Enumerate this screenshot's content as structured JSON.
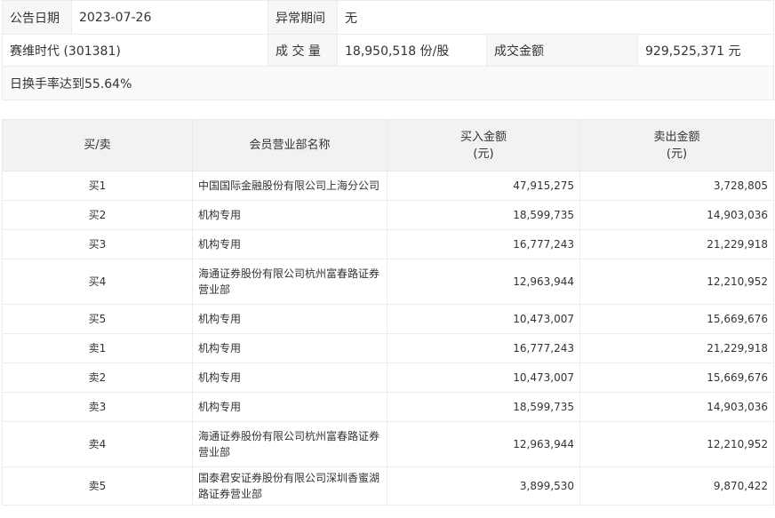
{
  "info": {
    "date_label": "公告日期",
    "date_value": "2023-07-26",
    "period_label": "异常期间",
    "period_value": "无",
    "stock_name": "赛维时代 (301381)",
    "volume_label": "成 交 量",
    "volume_value": "18,950,518 份/股",
    "amount_label": "成交金额",
    "amount_value": "929,525,371 元",
    "reason": "日换手率达到55.64%"
  },
  "table": {
    "headers": {
      "side": "买/卖",
      "branch": "会员营业部名称",
      "buy_line1": "买入金额",
      "buy_line2": "(元)",
      "sell_line1": "卖出金额",
      "sell_line2": "(元)"
    },
    "rows": [
      {
        "side": "买1",
        "branch": "中国国际金融股份有限公司上海分公司",
        "buy": "47,915,275",
        "sell": "3,728,805"
      },
      {
        "side": "买2",
        "branch": "机构专用",
        "buy": "18,599,735",
        "sell": "14,903,036"
      },
      {
        "side": "买3",
        "branch": "机构专用",
        "buy": "16,777,243",
        "sell": "21,229,918"
      },
      {
        "side": "买4",
        "branch": "海通证券股份有限公司杭州富春路证券营业部",
        "buy": "12,963,944",
        "sell": "12,210,952"
      },
      {
        "side": "买5",
        "branch": "机构专用",
        "buy": "10,473,007",
        "sell": "15,669,676"
      },
      {
        "side": "卖1",
        "branch": "机构专用",
        "buy": "16,777,243",
        "sell": "21,229,918"
      },
      {
        "side": "卖2",
        "branch": "机构专用",
        "buy": "10,473,007",
        "sell": "15,669,676"
      },
      {
        "side": "卖3",
        "branch": "机构专用",
        "buy": "18,599,735",
        "sell": "14,903,036"
      },
      {
        "side": "卖4",
        "branch": "海通证券股份有限公司杭州富春路证券营业部",
        "buy": "12,963,944",
        "sell": "12,210,952"
      },
      {
        "side": "卖5",
        "branch": "国泰君安证券股份有限公司深圳香蜜湖路证券营业部",
        "buy": "3,899,530",
        "sell": "9,870,422"
      }
    ]
  }
}
